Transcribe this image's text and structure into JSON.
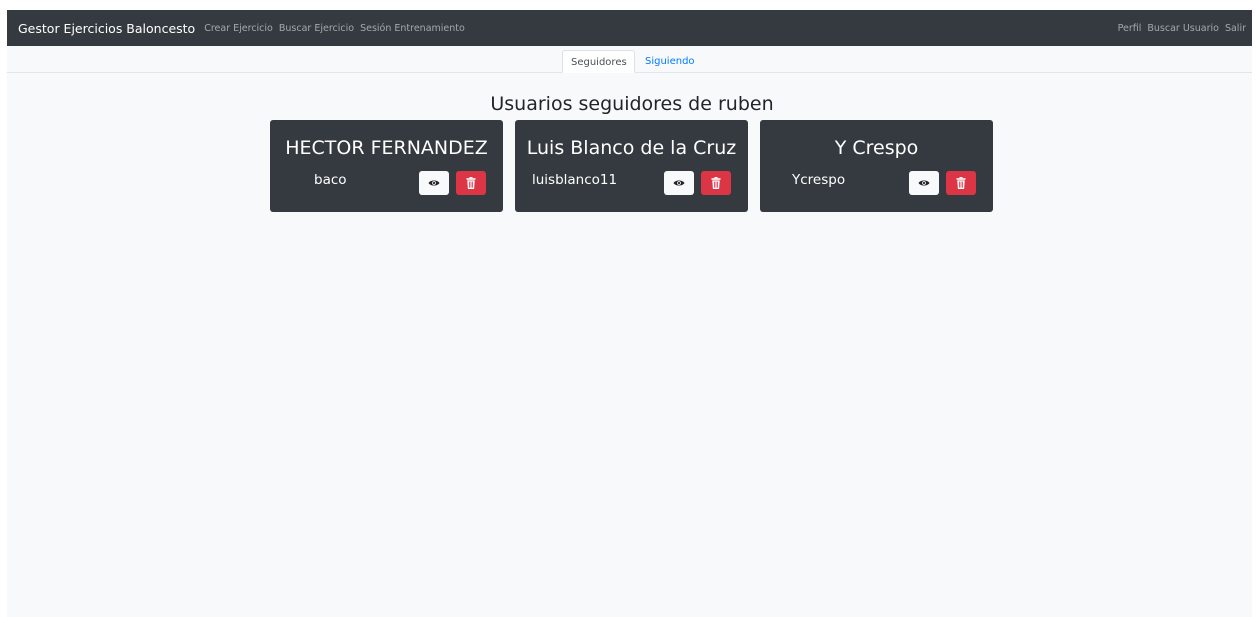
{
  "navbar": {
    "brand": "Gestor Ejercicios Baloncesto",
    "left_links": [
      "Crear Ejercicio",
      "Buscar Ejercicio",
      "Sesión Entrenamiento"
    ],
    "right_links": [
      "Perfil",
      "Buscar Usuario",
      "Salir"
    ]
  },
  "tabs": [
    {
      "label": "Seguidores",
      "active": true
    },
    {
      "label": "Siguiendo",
      "active": false
    }
  ],
  "page_title": "Usuarios seguidores de ruben",
  "followers": [
    {
      "name": "HECTOR FERNANDEZ",
      "username": "baco"
    },
    {
      "name": "Luis Blanco de la Cruz",
      "username": "luisblanco11"
    },
    {
      "name": "Y Crespo",
      "username": "Ycrespo"
    }
  ],
  "icons": {
    "view": "eye-icon",
    "delete": "trash-icon"
  },
  "colors": {
    "navbar_bg": "#343a40",
    "card_bg": "#343a40",
    "delete_button": "#dc3545",
    "view_button": "#f8f9fa",
    "link": "#007bff"
  }
}
